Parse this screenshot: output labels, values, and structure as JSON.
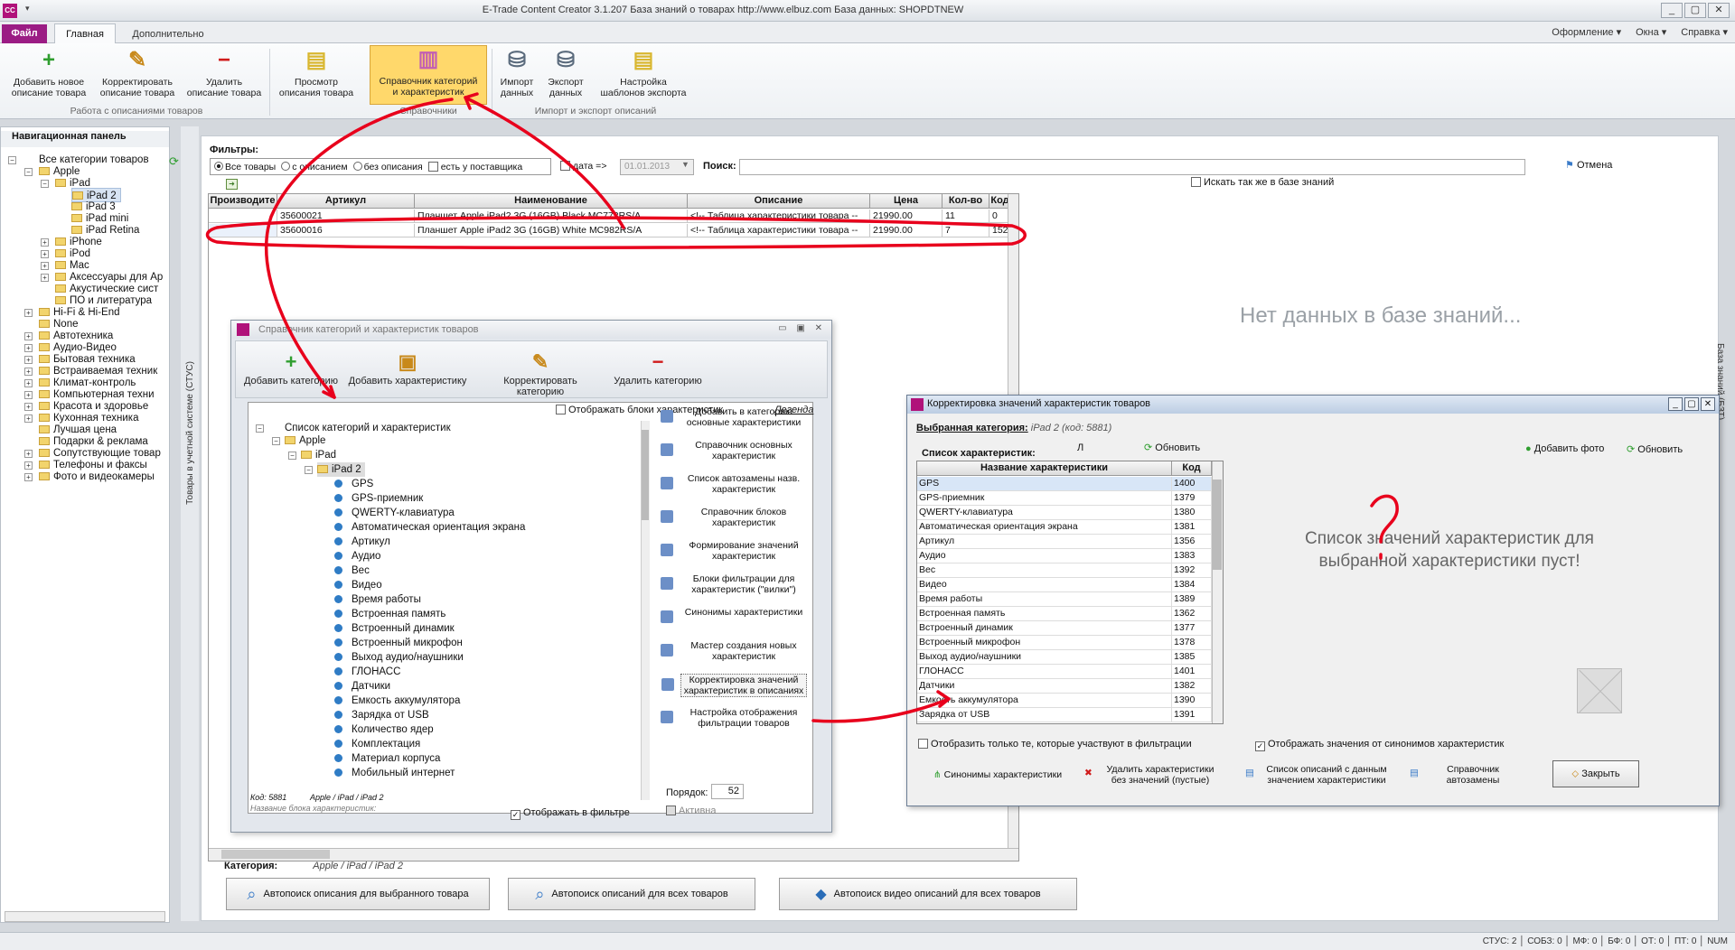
{
  "app": {
    "title": "E-Trade Content Creator 3.1.207     База знаний о товарах   http://www.elbuz.com    База данных: SHOPDTNEW",
    "qa": "▾",
    "tabs": {
      "file": "Файл",
      "main": "Главная",
      "extra": "Дополнительно"
    },
    "right_menu": [
      "Оформление ▾",
      "Окна ▾",
      "Справка ▾"
    ]
  },
  "ribbon": {
    "buttons": [
      {
        "label1": "Добавить новое",
        "label2": "описание товара",
        "icon": "plus-icon",
        "glyph": "+",
        "color": "#2f9e2f"
      },
      {
        "label1": "Корректировать",
        "label2": "описание товара",
        "icon": "pencil-icon",
        "glyph": "✎",
        "color": "#c8891b"
      },
      {
        "label1": "Удалить",
        "label2": "описание товара",
        "icon": "minus-icon",
        "glyph": "−",
        "color": "#d01b1b"
      },
      {
        "label1": "Просмотр",
        "label2": "описания товара",
        "icon": "document-icon",
        "glyph": "▤",
        "color": "#d9b730"
      },
      {
        "label1": "Справочник категорий",
        "label2": "и характеристик",
        "icon": "book-icon",
        "glyph": "▥",
        "color": "#c25fb3"
      },
      {
        "label1": "Импорт",
        "label2": "данных",
        "icon": "database-import-icon",
        "glyph": "⛁",
        "color": "#5b6b7d"
      },
      {
        "label1": "Экспорт",
        "label2": "данных",
        "icon": "database-export-icon",
        "glyph": "⛁",
        "color": "#5b6b7d"
      },
      {
        "label1": "Настройка",
        "label2": "шаблонов экспорта",
        "icon": "template-icon",
        "glyph": "▤",
        "color": "#d9b730"
      }
    ],
    "groups": [
      "Работа с описаниями товаров",
      "Справочники",
      "Импорт и экспорт описаний"
    ]
  },
  "nav": {
    "header": "Навигационная панель",
    "vtab": "Товары в учетной системе (СТУС)",
    "items": [
      "Все категории товаров",
      "Apple",
      "iPad",
      "iPad 2",
      "iPad 3",
      "iPad mini",
      "iPad Retina",
      "iPhone",
      "iPod",
      "Mac",
      "Аксессуары для Ap",
      "Акустические сист",
      "ПО и литература",
      "Hi-Fi & Hi-End",
      "None",
      "Автотехника",
      "Аудио-Видео",
      "Бытовая техника",
      "Встраиваемая техник",
      "Климат-контроль",
      "Компьютерная техни",
      "Красота и здоровье",
      "Кухонная техника",
      "Лучшая цена",
      "Подарки & реклама",
      "Сопутствующие товар",
      "Телефоны и факсы",
      "Фото и видеокамеры"
    ]
  },
  "filters": {
    "label": "Фильтры:",
    "options": [
      "Все товары",
      "с описанием",
      "без описания"
    ],
    "supplier": "есть у поставщика",
    "date_label": "дата =>",
    "date_value": "01.01.2013",
    "search_label": "Поиск:",
    "cancel": "Отмена",
    "kb_search": "Искать так же в базе знаний"
  },
  "grid": {
    "columns": [
      "Производите",
      "Артикул",
      "Наименование",
      "Описание",
      "Цена",
      "Кол-во",
      "Код"
    ],
    "rows": [
      [
        "",
        "35600021",
        "Планшет Apple iPad2 3G (16GB) Black MC773RS/A",
        "<!-- Таблица характеристики товара --",
        "21990.00",
        "11",
        "0"
      ],
      [
        "",
        "35600016",
        "Планшет Apple iPad2 3G (16GB) White MC982RS/A",
        "<!-- Таблица характеристики товара --",
        "21990.00",
        "7",
        "152"
      ]
    ]
  },
  "kb": {
    "nodata": "Нет данных в базе знаний...",
    "vtab": "База знаний (БЗТ)"
  },
  "category": {
    "label": "Категория:",
    "value": "Apple / iPad / iPad 2"
  },
  "bottom_buttons": [
    "Автопоиск описания для выбранного товара",
    "Автопоиск описаний для всех товаров",
    "Автопоиск видео описаний для всех товаров"
  ],
  "status": "СТУС: 2 │ СОБЗ: 0 │ МФ: 0 │ БФ: 0 │ ОТ: 0 │ ПТ: 0 │         NUM",
  "dlg1": {
    "title": "Справочник категорий и характеристик товаров",
    "ctrl": "▭ ▣ ✕",
    "tools": [
      "Добавить категорию",
      "Добавить характеристику",
      "Корректировать категорию",
      "Удалить категорию"
    ],
    "show_blocks": "Отображать блоки характеристик",
    "legend": "Легенда",
    "tree_root": "Список категорий и характеристик",
    "tree_path": [
      "Apple",
      "iPad",
      "iPad 2"
    ],
    "features": [
      "GPS",
      "GPS-приемник",
      "QWERTY-клавиатура",
      "Автоматическая ориентация экрана",
      "Артикул",
      "Аудио",
      "Вес",
      "Видео",
      "Время работы",
      "Встроенная память",
      "Встроенный динамик",
      "Встроенный микрофон",
      "Выход аудио/наушники",
      "ГЛОНАСС",
      "Датчики",
      "Емкость аккумулятора",
      "Зарядка от USB",
      "Количество ядер",
      "Комплектация",
      "Материал корпуса",
      "Мобильный интернет"
    ],
    "links": [
      [
        "Добавить в категорию",
        "основные характеристики"
      ],
      [
        "Справочник основных",
        "характеристик"
      ],
      [
        "Список автозамены назв.",
        "характеристик"
      ],
      [
        "Справочник блоков",
        "характеристик"
      ],
      [
        "Формирование значений",
        "характеристик"
      ],
      [
        "Блоки фильтрации для",
        "характеристик (\"вилки\")"
      ],
      [
        "Синонимы характеристики",
        ""
      ],
      [
        "Мастер создания новых",
        "характеристик"
      ],
      [
        "Корректировка значений",
        "характеристик в описаниях"
      ],
      [
        "Настройка отображения",
        "фильтрации товаров"
      ]
    ],
    "code": "Код: 5881",
    "path": "Apple / iPad / iPad 2",
    "block_name": "Название блока характеристик:",
    "show_filter": "Отображать в фильтре",
    "active": "Активна",
    "order_label": "Порядок:",
    "order_value": "52"
  },
  "dlg2": {
    "title": "Корректировка значений характеристик товаров",
    "selected_label": "Выбранная категория:",
    "selected_value": "iPad 2 (код: 5881)",
    "list_label": "Список характеристик:",
    "list_letter": "Л",
    "refresh": "Обновить",
    "add_photo": "Добавить фото",
    "columns": [
      "Название характеристики",
      "Код"
    ],
    "rows": [
      [
        "GPS",
        "1400"
      ],
      [
        "GPS-приемник",
        "1379"
      ],
      [
        "QWERTY-клавиатура",
        "1380"
      ],
      [
        "Автоматическая ориентация экрана",
        "1381"
      ],
      [
        "Артикул",
        "1356"
      ],
      [
        "Аудио",
        "1383"
      ],
      [
        "Вес",
        "1392"
      ],
      [
        "Видео",
        "1384"
      ],
      [
        "Время работы",
        "1389"
      ],
      [
        "Встроенная память",
        "1362"
      ],
      [
        "Встроенный динамик",
        "1377"
      ],
      [
        "Встроенный микрофон",
        "1378"
      ],
      [
        "Выход аудио/наушники",
        "1385"
      ],
      [
        "ГЛОНАСС",
        "1401"
      ],
      [
        "Датчики",
        "1382"
      ],
      [
        "Емкость аккумулятора",
        "1390"
      ],
      [
        "Зарядка от USB",
        "1391"
      ]
    ],
    "empty_msg": "Список значений характеристик для выбранной характеристики пуст!",
    "only_filter": "Отобразить только те, которые участвуют в фильтрации",
    "show_synonyms": "Отображать значения от синонимов характеристик",
    "buttons": [
      [
        "Синонимы характеристики",
        ""
      ],
      [
        "Удалить характеристики",
        "без значений (пустые)"
      ],
      [
        "Список описаний с данным",
        "значением характеристики"
      ],
      [
        "Справочник",
        "автозамены"
      ]
    ],
    "close": "Закрыть",
    "ctrl": [
      "_",
      "▢",
      "✕"
    ]
  },
  "colors": {
    "annotation": "#e8001c",
    "accent": "#9b1c84",
    "highlight": "#ffd86b"
  }
}
